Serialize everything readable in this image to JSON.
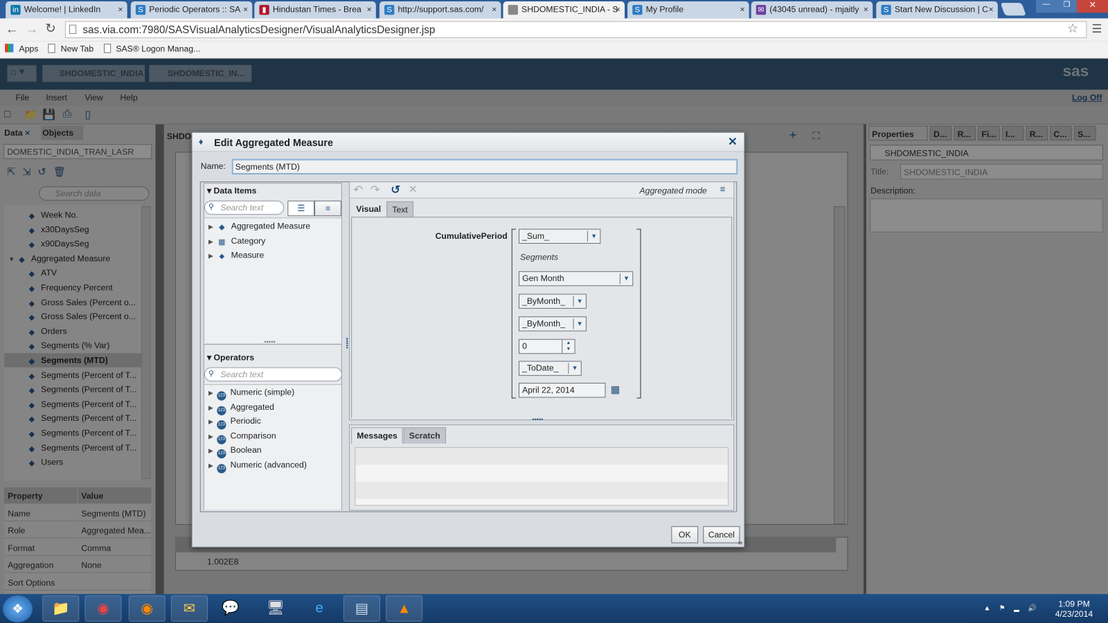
{
  "browser": {
    "tabs": [
      {
        "label": "Welcome! | LinkedIn",
        "icon": "linkedin-icon",
        "color": "#0e76a8"
      },
      {
        "label": "Periodic Operators :: SA",
        "icon": "sas-icon",
        "color": "#2e7bc4"
      },
      {
        "label": "Hindustan Times - Brea",
        "icon": "ht-icon",
        "color": "#b0142a"
      },
      {
        "label": "http://support.sas.com/",
        "icon": "sas-icon",
        "color": "#2e7bc4"
      },
      {
        "label": "SHDOMESTIC_INDIA - S",
        "icon": "page-icon",
        "color": "#888888"
      },
      {
        "label": "My Profile",
        "icon": "sas-icon",
        "color": "#2e7bc4"
      },
      {
        "label": "(43045 unread) - mjaitly",
        "icon": "mail-icon",
        "color": "#6b3fa0"
      },
      {
        "label": "Start New Discussion | C",
        "icon": "sas-icon",
        "color": "#2e7bc4"
      }
    ],
    "active_tab": 4,
    "url": "sas.via.com:7980/SASVisualAnalyticsDesigner/VisualAnalyticsDesigner.jsp",
    "bookmarks": [
      "Apps",
      "New Tab",
      "SAS® Logon Manag..."
    ]
  },
  "app": {
    "doc_tabs": [
      "SHDOMESTIC_INDIA",
      "SHDOMESTIC_IN..."
    ],
    "logo": "sas",
    "menu": [
      "File",
      "Insert",
      "View",
      "Help"
    ],
    "logoff": "Log Off",
    "left_tabs": [
      "Data",
      "Objects"
    ],
    "datasource": "DOMESTIC_INDIA_TRAN_LASR",
    "search_data_placeholder": "Search data",
    "data_items": [
      {
        "label": "Week No.",
        "level": 1
      },
      {
        "label": "x30DaysSeg",
        "level": 1
      },
      {
        "label": "x90DaysSeg",
        "level": 1
      },
      {
        "label": "Aggregated Measure",
        "level": 0
      },
      {
        "label": "ATV",
        "level": 1
      },
      {
        "label": "Frequency Percent",
        "level": 1
      },
      {
        "label": "Gross Sales (Percent o...",
        "level": 1
      },
      {
        "label": "Gross Sales (Percent o...",
        "level": 1
      },
      {
        "label": "Orders",
        "level": 1
      },
      {
        "label": "Segments (% Var)",
        "level": 1
      },
      {
        "label": "Segments (MTD)",
        "level": 1,
        "selected": true
      },
      {
        "label": "Segments (Percent of T...",
        "level": 1
      },
      {
        "label": "Segments (Percent of T...",
        "level": 1
      },
      {
        "label": "Segments (Percent of T...",
        "level": 1
      },
      {
        "label": "Segments (Percent of T...",
        "level": 1
      },
      {
        "label": "Segments (Percent of T...",
        "level": 1
      },
      {
        "label": "Segments (Percent of T...",
        "level": 1
      },
      {
        "label": "Users",
        "level": 1
      }
    ],
    "properties_header": [
      "Property",
      "Value"
    ],
    "properties": [
      [
        "Name",
        "Segments (MTD)"
      ],
      [
        "Role",
        "Aggregated Mea..."
      ],
      [
        "Format",
        "Comma"
      ],
      [
        "Aggregation",
        "None"
      ],
      [
        "Sort Options",
        ""
      ]
    ],
    "canvas_tab": "SHDO",
    "table_value": "1.002E8",
    "right_tabs": [
      "Properties",
      "D...",
      "R...",
      "Fi...",
      "I...",
      "R...",
      "C...",
      "S..."
    ],
    "right_object": "SHDOMESTIC_INDIA",
    "title_label": "Title:",
    "title_value": "SHDOMESTIC_INDIA",
    "description_label": "Description:"
  },
  "dialog": {
    "title": "Edit Aggregated Measure",
    "name_label": "Name:",
    "name_value": "Segments (MTD)",
    "data_items_header": "Data Items",
    "search_placeholder": "Search text",
    "data_item_groups": [
      "Aggregated Measure",
      "Category",
      "Measure"
    ],
    "operators_header": "Operators",
    "operators": [
      "Numeric (simple)",
      "Aggregated",
      "Periodic",
      "Comparison",
      "Boolean",
      "Numeric (advanced)"
    ],
    "mode": "Aggregated mode",
    "tabs": [
      "Visual",
      "Text"
    ],
    "active_tab": "Visual",
    "expression": {
      "function": "CumulativePeriod",
      "aggregation": "_Sum_",
      "measure": "Segments",
      "date_item": "Gen Month",
      "interval": "_ByMonth_",
      "scope": "_ByMonth_",
      "offset": "0",
      "period": "_ToDate_",
      "date": "April 22, 2014"
    },
    "bottom_tabs": [
      "Messages",
      "Scratch"
    ],
    "ok": "OK",
    "cancel": "Cancel"
  },
  "taskbar": {
    "time": "1:09 PM",
    "date": "4/23/2014"
  }
}
